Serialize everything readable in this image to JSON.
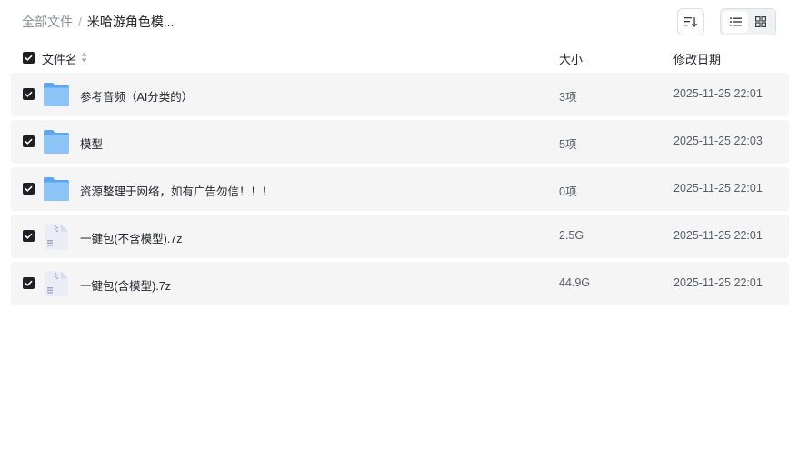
{
  "breadcrumb": {
    "root": "全部文件",
    "separator": "/",
    "current": "米哈游角色模..."
  },
  "toolbar": {
    "sort_icon": "sort-icon",
    "view_list_icon": "list-view-icon",
    "view_grid_icon": "grid-view-icon",
    "active_view": "list"
  },
  "columns": {
    "name": "文件名",
    "size": "大小",
    "date": "修改日期"
  },
  "files": [
    {
      "type": "folder",
      "name": "参考音频（AI分类的）",
      "size": "3项",
      "date": "2025-11-25 22:01",
      "checked": true
    },
    {
      "type": "folder",
      "name": "模型",
      "size": "5项",
      "date": "2025-11-25 22:03",
      "checked": true
    },
    {
      "type": "folder",
      "name": "资源整理于网络，如有广告勿信！！！",
      "size": "0项",
      "date": "2025-11-25 22:01",
      "checked": true
    },
    {
      "type": "archive",
      "name": "一键包(不含模型).7z",
      "size": "2.5G",
      "date": "2025-11-25 22:01",
      "checked": true
    },
    {
      "type": "archive",
      "name": "一键包(含模型).7z",
      "size": "44.9G",
      "date": "2025-11-25 22:01",
      "checked": true
    }
  ],
  "colors": {
    "row_background": "#f5f5f6",
    "checkbox": "#1f2025",
    "folder": "#7ab8f5"
  }
}
